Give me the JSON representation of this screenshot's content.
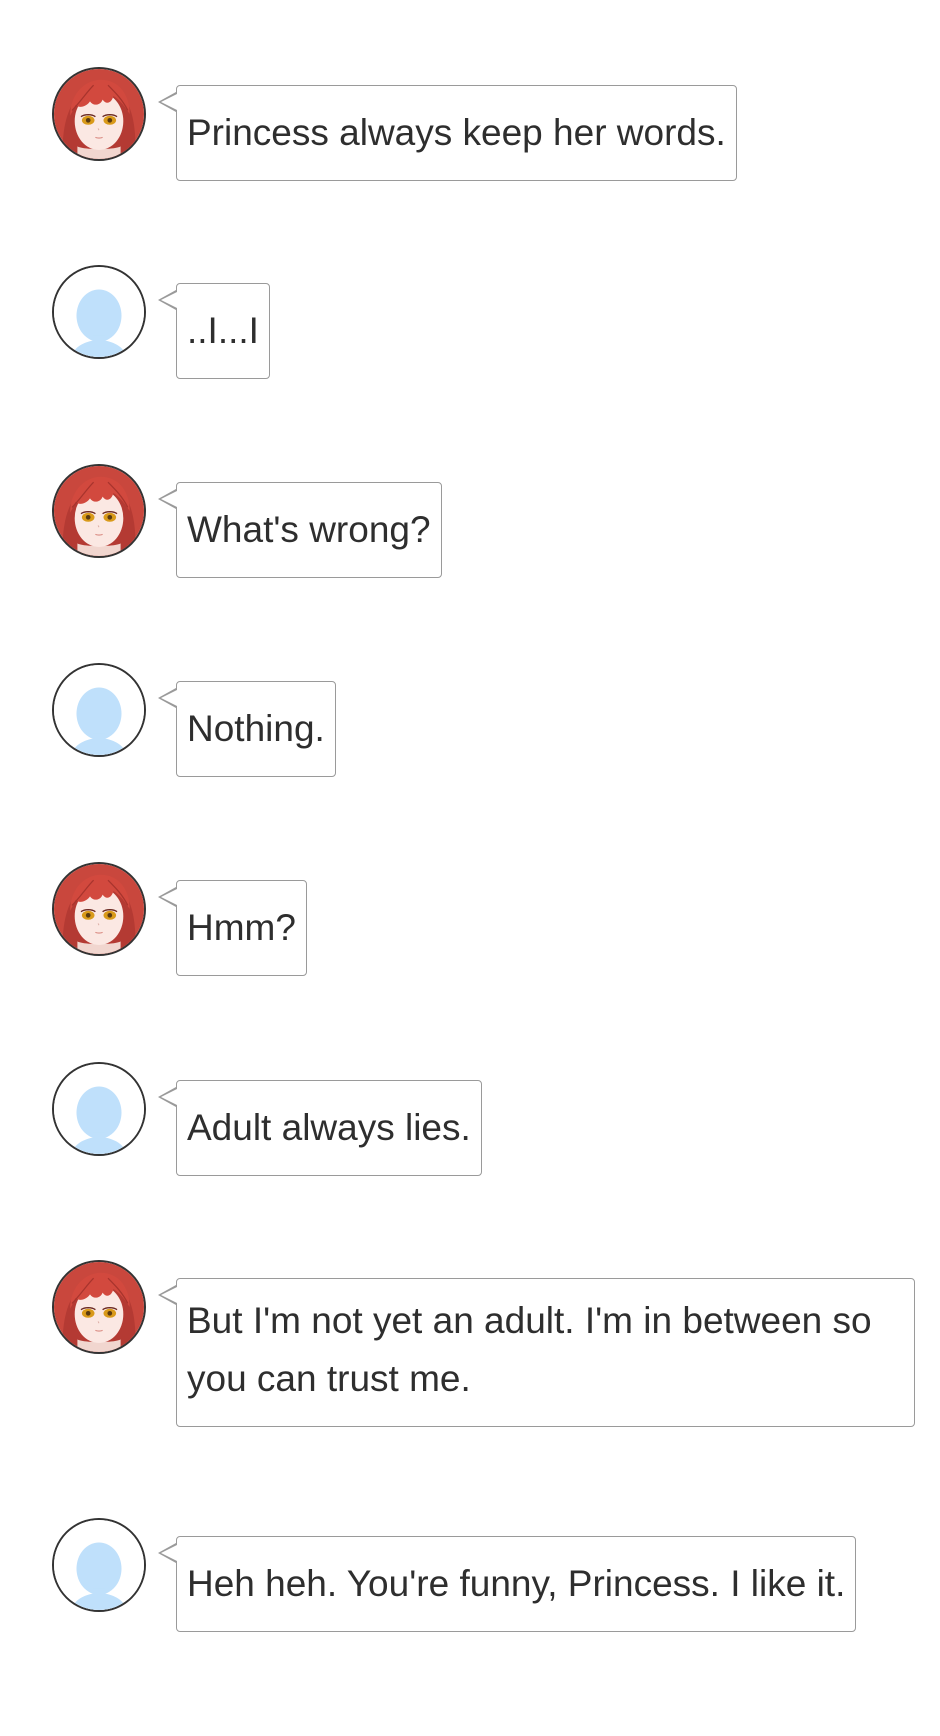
{
  "conversation": {
    "messages": [
      {
        "speaker": "princess",
        "avatar_icon": "princess-avatar-icon",
        "text": "Princess always keep her words."
      },
      {
        "speaker": "user",
        "avatar_icon": "default-user-avatar-icon",
        "text": "..I...I"
      },
      {
        "speaker": "princess",
        "avatar_icon": "princess-avatar-icon",
        "text": "What's wrong?"
      },
      {
        "speaker": "user",
        "avatar_icon": "default-user-avatar-icon",
        "text": "Nothing."
      },
      {
        "speaker": "princess",
        "avatar_icon": "princess-avatar-icon",
        "text": "Hmm?"
      },
      {
        "speaker": "user",
        "avatar_icon": "default-user-avatar-icon",
        "text": "Adult always lies."
      },
      {
        "speaker": "princess",
        "avatar_icon": "princess-avatar-icon",
        "text": "But I'm not yet an adult. I'm in between so you can trust me."
      },
      {
        "speaker": "user",
        "avatar_icon": "default-user-avatar-icon",
        "text": "Heh heh. You're funny, Princess. I like it."
      }
    ]
  },
  "colors": {
    "princess_hair": "#c9473d",
    "princess_eyes": "#d99a1a",
    "user_silhouette": "#bfe0fb",
    "bubble_border": "#9a9a9a",
    "text": "#2e2e2e"
  }
}
